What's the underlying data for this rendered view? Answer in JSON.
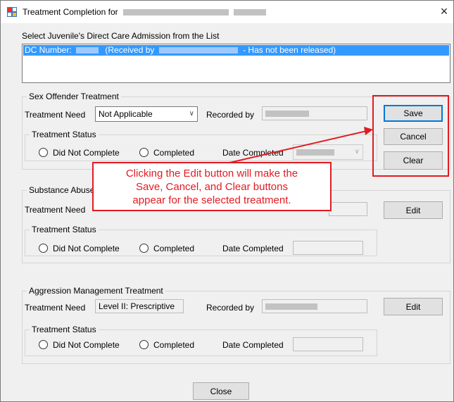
{
  "window": {
    "title": "Treatment Completion for",
    "close_glyph": "×"
  },
  "admission": {
    "header": "Select Juvenile's Direct Care Admission from the List",
    "row": {
      "prefix": "DC Number:",
      "received": "(Received by",
      "status": "- Has not been released)"
    }
  },
  "sex_offender": {
    "group_title": "Sex Offender Treatment",
    "need_label": "Treatment Need",
    "need_value": "Not Applicable",
    "recorded_label": "Recorded by",
    "status_title": "Treatment Status",
    "did_not_complete": "Did Not Complete",
    "completed": "Completed",
    "date_label": "Date Completed",
    "buttons": {
      "save": "Save",
      "cancel": "Cancel",
      "clear": "Clear"
    }
  },
  "substance_abuse": {
    "group_title": "Substance Abuse",
    "need_label": "Treatment Need",
    "status_title": "Treatment Status",
    "did_not_complete": "Did Not Complete",
    "completed": "Completed",
    "date_label": "Date Completed",
    "edit": "Edit"
  },
  "aggression": {
    "group_title": "Aggression Management Treatment",
    "need_label": "Treatment Need",
    "need_value": "Level II: Prescriptive",
    "recorded_label": "Recorded by",
    "status_title": "Treatment Status",
    "did_not_complete": "Did Not Complete",
    "completed": "Completed",
    "date_label": "Date Completed",
    "edit": "Edit"
  },
  "footer": {
    "close": "Close"
  },
  "callout": {
    "line1": "Clicking the Edit button will make the",
    "line2": "Save, Cancel, and Clear buttons",
    "line3": "appear for the selected treatment."
  },
  "colors": {
    "accent": "#e11b22",
    "selection": "#3399ff",
    "default_button_border": "#0078d7"
  }
}
